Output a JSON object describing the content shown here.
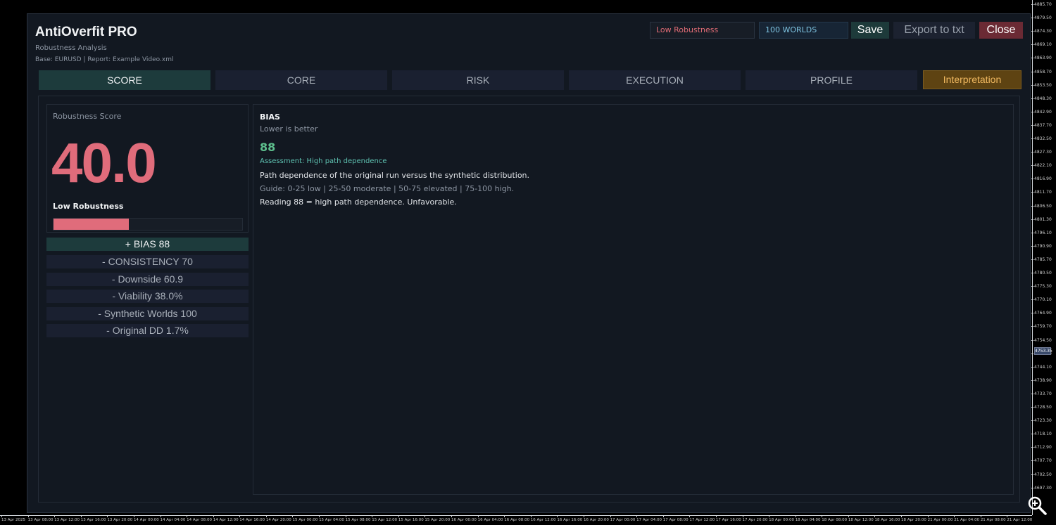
{
  "header": {
    "title": "AntiOverfit PRO",
    "subtitle": "Robustness Analysis",
    "meta": "Base: EURUSD | Report: Example Video.xml",
    "status_pill": "Low Robustness",
    "worlds_pill": "100 WORLDS",
    "save_label": "Save",
    "export_label": "Export to txt",
    "close_label": "Close"
  },
  "tabs": [
    {
      "label": "SCORE",
      "active": true
    },
    {
      "label": "CORE",
      "active": false
    },
    {
      "label": "RISK",
      "active": false
    },
    {
      "label": "EXECUTION",
      "active": false
    },
    {
      "label": "PROFILE",
      "active": false
    }
  ],
  "interpretation_label": "Interpretation",
  "score_card": {
    "label": "Robustness Score",
    "value": "40.0",
    "rating": "Low Robustness",
    "bar_fraction": 0.4
  },
  "metrics": [
    {
      "label": "+ BIAS  88",
      "active": true
    },
    {
      "label": "- CONSISTENCY  70",
      "active": false
    },
    {
      "label": "- Downside  60.9",
      "active": false
    },
    {
      "label": "- Viability  38.0%",
      "active": false
    },
    {
      "label": "- Synthetic Worlds  100",
      "active": false
    },
    {
      "label": "- Original DD  1.7%",
      "active": false
    }
  ],
  "detail": {
    "title": "BIAS",
    "hint": "Lower is better",
    "value": "88",
    "assessment": "Assessment: High path dependence",
    "description": "Path dependence of the original run versus the synthetic distribution.",
    "guide": "Guide: 0-25 low | 25-50 moderate | 50-75 elevated | 75-100 high.",
    "reading": "Reading 88 = high path dependence. Unfavorable."
  },
  "price_axis": [
    "4885.70",
    "4879.50",
    "4874.30",
    "4869.10",
    "4863.90",
    "4858.70",
    "4853.50",
    "4848.30",
    "4842.90",
    "4837.70",
    "4832.50",
    "4827.30",
    "4822.10",
    "4816.90",
    "4811.70",
    "4806.50",
    "4801.30",
    "4796.10",
    "4790.90",
    "4785.70",
    "4780.50",
    "4775.30",
    "4770.10",
    "4764.90",
    "4759.70",
    "4754.50",
    "4749.30",
    "4744.10",
    "4738.90",
    "4733.70",
    "4728.50",
    "4723.30",
    "4718.10",
    "4712.90",
    "4707.70",
    "4702.50",
    "4697.30"
  ],
  "price_marker": "4753.35",
  "time_axis": [
    "13 Apr 2025",
    "13 Apr 08:00",
    "13 Apr 12:00",
    "13 Apr 16:00",
    "13 Apr 20:00",
    "14 Apr 00:00",
    "14 Apr 04:00",
    "14 Apr 08:00",
    "14 Apr 12:00",
    "14 Apr 16:00",
    "14 Apr 20:00",
    "15 Apr 00:00",
    "15 Apr 04:00",
    "15 Apr 08:00",
    "15 Apr 12:00",
    "15 Apr 16:00",
    "15 Apr 20:00",
    "16 Apr 00:00",
    "16 Apr 04:00",
    "16 Apr 08:00",
    "16 Apr 12:00",
    "16 Apr 16:00",
    "16 Apr 20:00",
    "17 Apr 00:00",
    "17 Apr 04:00",
    "17 Apr 08:00",
    "17 Apr 12:00",
    "17 Apr 16:00",
    "17 Apr 20:00",
    "18 Apr 00:00",
    "18 Apr 04:00",
    "18 Apr 08:00",
    "18 Apr 12:00",
    "18 Apr 16:00",
    "18 Apr 20:00",
    "21 Apr 00:00",
    "21 Apr 04:00",
    "21 Apr 08:00",
    "21 Apr 12:00"
  ]
}
